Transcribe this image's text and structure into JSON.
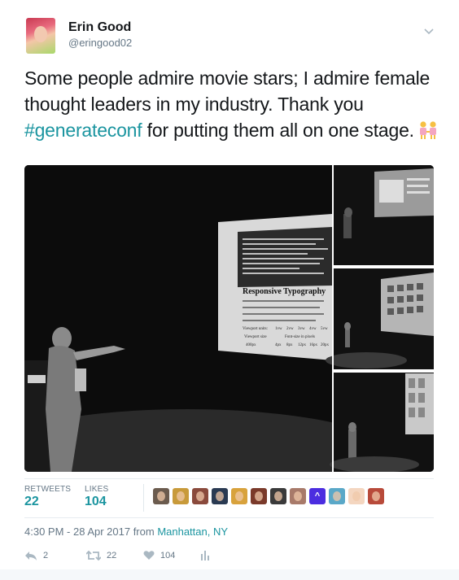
{
  "author": {
    "name": "Erin Good",
    "handle": "@eringood02"
  },
  "tweet": {
    "text_before": "Some people admire movie stars; I admire female thought leaders in my industry. Thank you ",
    "hashtag": "#generateconf",
    "text_after": " for putting them all on one stage.",
    "emoji": "two-women-holding-hands-emoji"
  },
  "slide": {
    "heading": "Responsive Typography",
    "table_header": [
      "Viewport units:",
      "1vw",
      "2vw",
      "3vw",
      "4vw",
      "5vw"
    ],
    "table_sub": [
      "Viewport size",
      "Font-size in pixels"
    ],
    "table_row": [
      "400px",
      "4px",
      "8px",
      "12px",
      "16px",
      "20px"
    ]
  },
  "stats": {
    "retweets_label": "RETWEETS",
    "retweets": "22",
    "likes_label": "LIKES",
    "likes": "104"
  },
  "likers": [
    {
      "icon": "avatar-1",
      "color": "#6b5b4e"
    },
    {
      "icon": "avatar-2",
      "color": "#c89a3a"
    },
    {
      "icon": "avatar-3",
      "color": "#8a4a3c"
    },
    {
      "icon": "avatar-4",
      "color": "#2a3a52"
    },
    {
      "icon": "avatar-5",
      "color": "#d8a23c"
    },
    {
      "icon": "avatar-6",
      "color": "#7a3a2a"
    },
    {
      "icon": "avatar-7",
      "color": "#3a3a3a"
    },
    {
      "icon": "avatar-8",
      "color": "#a87a6a"
    },
    {
      "icon": "avatar-9",
      "color": "#4b2de0",
      "text": "^"
    },
    {
      "icon": "avatar-10",
      "color": "#5aa8c8"
    },
    {
      "icon": "avatar-11",
      "color": "#f4d6c0"
    },
    {
      "icon": "avatar-12",
      "color": "#b84a3a"
    }
  ],
  "timestamp": "4:30 PM - 28 Apr 2017 from ",
  "location": "Manhattan, NY",
  "actions": {
    "replies": "2",
    "retweets": "22",
    "likes": "104"
  },
  "colors": {
    "accent": "#1b95a0",
    "muted": "#657786"
  }
}
